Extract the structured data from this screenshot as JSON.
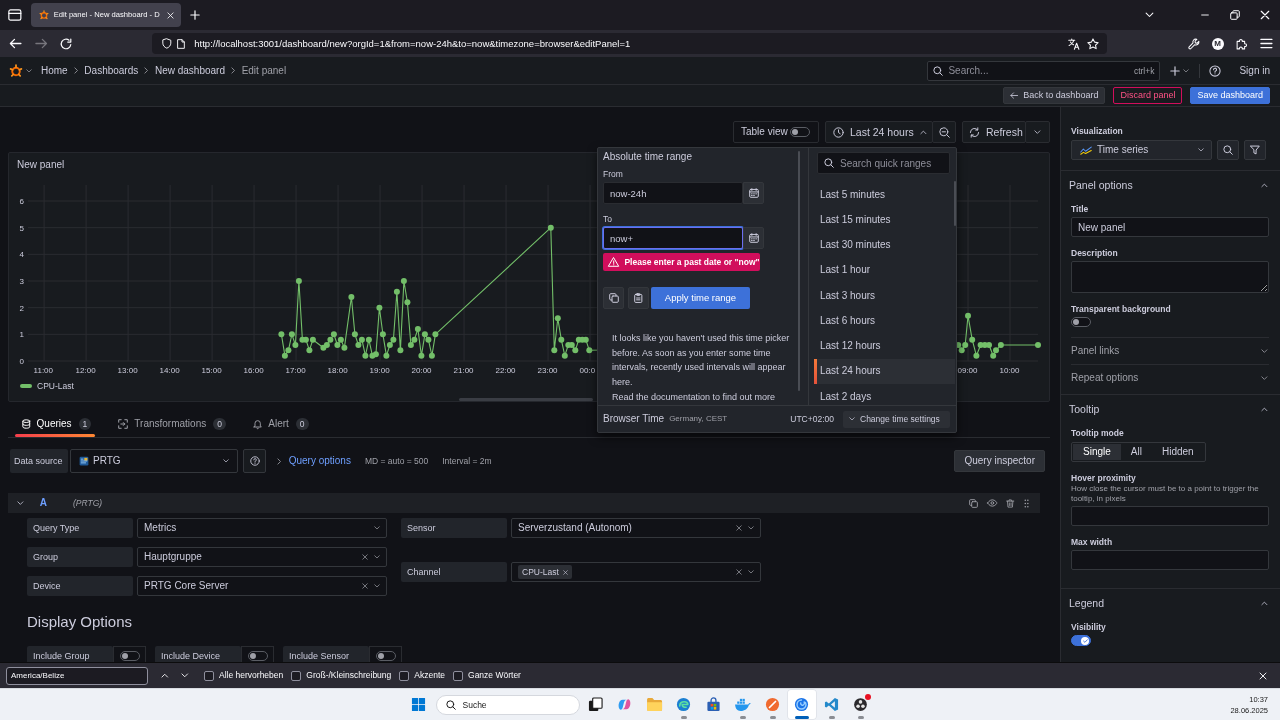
{
  "browser": {
    "tab_title": "Edit panel - New dashboard - D",
    "url": "http://localhost:3001/dashboard/new?orgId=1&from=now-24h&to=now&timezone=browser&editPanel=1",
    "profile_initial": "M"
  },
  "topnav": {
    "breadcrumbs": [
      "Home",
      "Dashboards",
      "New dashboard",
      "Edit panel"
    ],
    "search_placeholder": "Search...",
    "search_shortcut": "ctrl+k",
    "sign_in": "Sign in"
  },
  "toolbar": {
    "buttons": [
      {
        "label": "Back to dashboard",
        "kind": "back"
      },
      {
        "label": "Discard panel",
        "kind": "danger"
      },
      {
        "label": "Save dashboard",
        "kind": "primary"
      }
    ]
  },
  "panel_controls": {
    "table_view": {
      "label": "Table view",
      "on": false
    },
    "time_range": {
      "label": "Last 24 hours",
      "expanded": true
    },
    "refresh": "Refresh"
  },
  "panel": {
    "title": "New panel",
    "chart_data": [
      {
        "type": "line",
        "marker": "circle",
        "grid": true,
        "legend": "bottom",
        "xlim": [
          "2025-06-27T10:37",
          "2025-06-28T10:40"
        ],
        "ylim": [
          0,
          6.6
        ],
        "yticks": [
          0,
          1,
          2,
          3,
          4,
          5,
          6
        ],
        "xticks": [
          {
            "value": "2025-06-27T11:00",
            "label": "11:00"
          },
          {
            "value": "2025-06-27T12:00",
            "label": "12:00"
          },
          {
            "value": "2025-06-27T13:00",
            "label": "13:00"
          },
          {
            "value": "2025-06-27T14:00",
            "label": "14:00"
          },
          {
            "value": "2025-06-27T15:00",
            "label": "15:00"
          },
          {
            "value": "2025-06-27T16:00",
            "label": "16:00"
          },
          {
            "value": "2025-06-27T17:00",
            "label": "17:00"
          },
          {
            "value": "2025-06-27T18:00",
            "label": "18:00"
          },
          {
            "value": "2025-06-27T19:00",
            "label": "19:00"
          },
          {
            "value": "2025-06-27T20:00",
            "label": "20:00"
          },
          {
            "value": "2025-06-27T21:00",
            "label": "21:00"
          },
          {
            "value": "2025-06-27T22:00",
            "label": "22:00"
          },
          {
            "value": "2025-06-27T23:00",
            "label": "23:00"
          },
          {
            "value": "2025-06-28T00:00",
            "label": "00:0"
          },
          {
            "value": "2025-06-28T09:00",
            "label": "09:00"
          },
          {
            "value": "2025-06-28T10:00",
            "label": "10:00"
          }
        ],
        "series": [
          {
            "name": "CPU-Last",
            "color": "#73bf69",
            "x": [
              "2025-06-27T16:39",
              "2025-06-27T16:44",
              "2025-06-27T16:49",
              "2025-06-27T16:54",
              "2025-06-27T16:59",
              "2025-06-27T17:04",
              "2025-06-27T17:09",
              "2025-06-27T17:14",
              "2025-06-27T17:19",
              "2025-06-27T17:24",
              "2025-06-27T17:39",
              "2025-06-27T17:44",
              "2025-06-27T17:49",
              "2025-06-27T17:54",
              "2025-06-27T17:59",
              "2025-06-27T18:04",
              "2025-06-27T18:09",
              "2025-06-27T18:19",
              "2025-06-27T18:24",
              "2025-06-27T18:29",
              "2025-06-27T18:34",
              "2025-06-27T18:39",
              "2025-06-27T18:44",
              "2025-06-27T18:49",
              "2025-06-27T18:54",
              "2025-06-27T18:59",
              "2025-06-27T19:04",
              "2025-06-27T19:09",
              "2025-06-27T19:14",
              "2025-06-27T19:19",
              "2025-06-27T19:24",
              "2025-06-27T19:29",
              "2025-06-27T19:34",
              "2025-06-27T19:39",
              "2025-06-27T19:44",
              "2025-06-27T19:49",
              "2025-06-27T19:54",
              "2025-06-27T19:59",
              "2025-06-27T20:04",
              "2025-06-27T20:09",
              "2025-06-27T20:14",
              "2025-06-27T20:19",
              "2025-06-27T23:04",
              "2025-06-27T23:09",
              "2025-06-27T23:14",
              "2025-06-27T23:19",
              "2025-06-27T23:24",
              "2025-06-27T23:29",
              "2025-06-27T23:34",
              "2025-06-27T23:39",
              "2025-06-27T23:44",
              "2025-06-27T23:49",
              "2025-06-27T23:54",
              "2025-06-27T23:59",
              "2025-06-28T08:46",
              "2025-06-28T08:51",
              "2025-06-28T08:56",
              "2025-06-28T09:00",
              "2025-06-28T09:06",
              "2025-06-28T09:12",
              "2025-06-28T09:18",
              "2025-06-28T09:24",
              "2025-06-28T09:30",
              "2025-06-28T09:36",
              "2025-06-28T09:40",
              "2025-06-28T09:47",
              "2025-06-28T10:40"
            ],
            "values": [
              1.0,
              0.2,
              0.4,
              1.0,
              0.6,
              3.0,
              0.8,
              0.8,
              0.4,
              0.8,
              0.5,
              0.6,
              0.8,
              1.0,
              0.6,
              0.8,
              0.5,
              2.4,
              1.0,
              0.6,
              0.8,
              0.2,
              0.8,
              0.2,
              0.25,
              2.0,
              1.0,
              0.2,
              0.6,
              0.8,
              2.6,
              0.4,
              3.0,
              2.2,
              0.6,
              0.8,
              1.2,
              0.2,
              1.0,
              0.8,
              0.2,
              1.0,
              5.0,
              0.4,
              1.6,
              0.8,
              0.2,
              0.6,
              0.6,
              0.4,
              0.8,
              0.8,
              0.8,
              0.4,
              0.6,
              0.4,
              0.6,
              1.7,
              0.8,
              0.2,
              0.6,
              0.6,
              0.6,
              0.2,
              0.4,
              0.6,
              0.6
            ]
          }
        ]
      }
    ]
  },
  "time_picker": {
    "title": "Absolute time range",
    "from": {
      "label": "From",
      "value": "now-24h",
      "focused": false
    },
    "to": {
      "label": "To",
      "value": "now+",
      "focused": true
    },
    "error": "Please enter a past date or \"now\"",
    "apply": "Apply time range",
    "note": "It looks like you haven't used this time picker before. As soon as you enter some time intervals, recently used intervals will appear here.",
    "doc_link": "Read the documentation",
    "doc_tail": "to find out more",
    "search_placeholder": "Search quick ranges",
    "quick_ranges": [
      {
        "label": "Last 5 minutes",
        "selected": false
      },
      {
        "label": "Last 15 minutes",
        "selected": false
      },
      {
        "label": "Last 30 minutes",
        "selected": false
      },
      {
        "label": "Last 1 hour",
        "selected": false
      },
      {
        "label": "Last 3 hours",
        "selected": false
      },
      {
        "label": "Last 6 hours",
        "selected": false
      },
      {
        "label": "Last 12 hours",
        "selected": false
      },
      {
        "label": "Last 24 hours",
        "selected": true
      },
      {
        "label": "Last 2 days",
        "selected": false
      }
    ],
    "footer": {
      "zone": "Browser Time",
      "zone_detail": "Germany, CEST",
      "offset": "UTC+02:00",
      "change": "Change time settings"
    }
  },
  "query_tabs": [
    {
      "label": "Queries",
      "count": "1",
      "selected": true
    },
    {
      "label": "Transformations",
      "count": "0",
      "selected": false
    },
    {
      "label": "Alert",
      "count": "0",
      "selected": false
    }
  ],
  "data_source": {
    "label": "Data source",
    "value": "PRTG",
    "query_options": "Query options",
    "max_data_points": "MD = auto = 500",
    "interval": "Interval = 2m",
    "inspector": "Query inspector"
  },
  "query": {
    "ref": "A",
    "source": "(PRTG)",
    "expanded": true,
    "left_fields": [
      {
        "label": "Query Type",
        "value": "Metrics",
        "clearable": false
      },
      {
        "label": "Group",
        "value": "Hauptgruppe",
        "clearable": true
      },
      {
        "label": "Device",
        "value": "PRTG Core Server",
        "clearable": true
      }
    ],
    "right_fields": [
      {
        "label": "Sensor",
        "value": "Serverzustand (Autonom)",
        "clearable": true
      },
      {
        "label": "Channel",
        "tags": [
          "CPU-Last"
        ],
        "clearable": true
      }
    ]
  },
  "display_options": {
    "title": "Display Options",
    "toggles": [
      {
        "label": "Include Group",
        "on": false
      },
      {
        "label": "Include Device",
        "on": false
      },
      {
        "label": "Include Sensor",
        "on": false
      }
    ]
  },
  "options_pane": {
    "visualization": {
      "label": "Visualization",
      "value": "Time series"
    },
    "groups": [
      {
        "title": "Panel options",
        "expanded": true,
        "items": [
          {
            "kind": "input",
            "label": "Title",
            "value": "New panel"
          },
          {
            "kind": "textarea",
            "label": "Description"
          },
          {
            "kind": "switch",
            "label": "Transparent background",
            "on": false
          },
          {
            "kind": "subgroup",
            "label": "Panel links",
            "expanded": false
          },
          {
            "kind": "subgroup",
            "label": "Repeat options",
            "expanded": false
          }
        ]
      },
      {
        "title": "Tooltip",
        "expanded": true,
        "items": [
          {
            "kind": "radio",
            "label": "Tooltip mode",
            "options": [
              {
                "label": "Single",
                "selected": true
              },
              {
                "label": "All",
                "selected": false
              },
              {
                "label": "Hidden",
                "selected": false
              }
            ]
          },
          {
            "kind": "input",
            "label": "Hover proximity",
            "description": "How close the cursor must be to a point to trigger the tooltip, in pixels"
          },
          {
            "kind": "input",
            "label": "Max width"
          }
        ]
      },
      {
        "title": "Legend",
        "expanded": true,
        "items": [
          {
            "kind": "switch",
            "label": "Visibility",
            "on": true
          }
        ]
      }
    ]
  },
  "find_bar": {
    "value": "America/Belize",
    "options": [
      {
        "label": "Alle hervorheben",
        "checked": false
      },
      {
        "label": "Groß-/Kleinschreibung",
        "checked": false
      },
      {
        "label": "Akzente",
        "checked": false
      },
      {
        "label": "Ganze Wörter",
        "checked": false
      }
    ]
  },
  "taskbar": {
    "search_placeholder": "Suche",
    "apps": [
      {
        "kind": "stacked_squares",
        "running": false,
        "active": false,
        "badge": false
      },
      {
        "kind": "swirl",
        "running": false,
        "active": false,
        "badge": false
      },
      {
        "kind": "folder",
        "running": false,
        "active": false,
        "badge": false
      },
      {
        "kind": "wave_circle",
        "running": true,
        "active": false,
        "badge": false
      },
      {
        "kind": "bag",
        "running": false,
        "active": false,
        "badge": false
      },
      {
        "kind": "whale",
        "running": true,
        "active": false,
        "badge": false
      },
      {
        "kind": "slash_circle",
        "running": true,
        "active": false,
        "badge": false
      },
      {
        "kind": "swirl_circle",
        "running": true,
        "active": true,
        "badge": false
      },
      {
        "kind": "ribbon",
        "running": true,
        "active": false,
        "badge": false
      },
      {
        "kind": "dots_circle",
        "running": true,
        "active": false,
        "badge": true
      }
    ],
    "time": "10:37",
    "date": "28.06.2025"
  }
}
